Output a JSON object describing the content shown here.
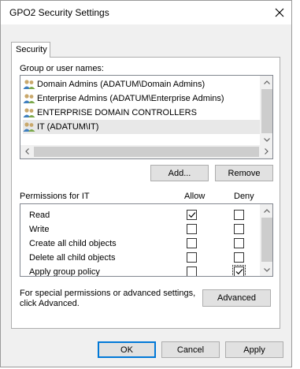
{
  "window": {
    "title": "GPO2 Security Settings"
  },
  "tabs": [
    {
      "label": "Security"
    }
  ],
  "groups": {
    "label": "Group or user names:",
    "items": [
      {
        "label": "Domain Admins (ADATUM\\Domain Admins)"
      },
      {
        "label": "Enterprise Admins (ADATUM\\Enterprise Admins)"
      },
      {
        "label": "ENTERPRISE DOMAIN CONTROLLERS"
      },
      {
        "label": "IT (ADATUM\\IT)",
        "selected": true
      }
    ],
    "add_label": "Add...",
    "remove_label": "Remove"
  },
  "permissions": {
    "header": "Permissions for IT",
    "allow_header": "Allow",
    "deny_header": "Deny",
    "rows": [
      {
        "name": "Read",
        "allow": true,
        "deny": false
      },
      {
        "name": "Write",
        "allow": false,
        "deny": false
      },
      {
        "name": "Create all child objects",
        "allow": false,
        "deny": false
      },
      {
        "name": "Delete all child objects",
        "allow": false,
        "deny": false
      },
      {
        "name": "Apply group policy",
        "allow": false,
        "deny": true
      }
    ]
  },
  "advanced": {
    "text": "For special permissions or advanced settings, click Advanced.",
    "button_label": "Advanced"
  },
  "footer": {
    "ok_label": "OK",
    "cancel_label": "Cancel",
    "apply_label": "Apply"
  },
  "colors": {
    "accent": "#0078d7",
    "button_bg": "#e1e1e1",
    "dialog_bg": "#f0f0f0"
  }
}
